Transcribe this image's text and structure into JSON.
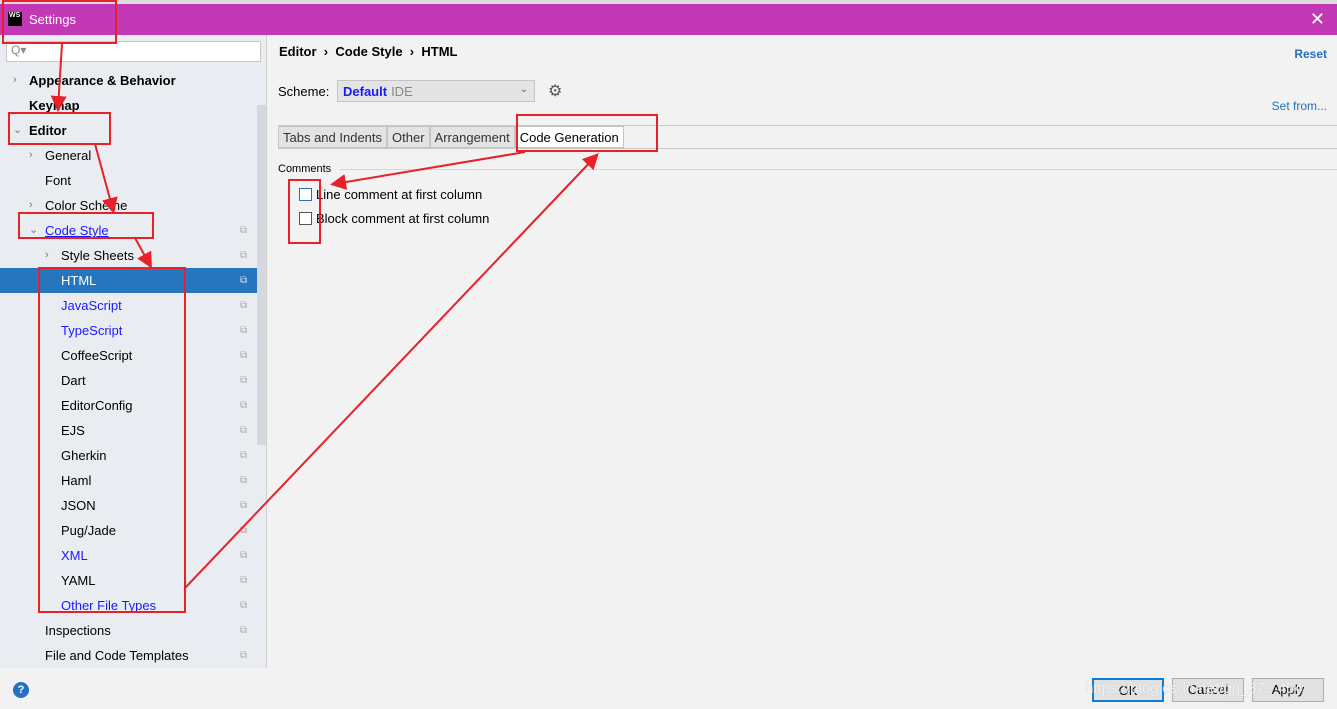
{
  "window": {
    "title": "Settings",
    "logo": "WS",
    "close_icon": "close-icon"
  },
  "sidebar": {
    "search_placeholder": "Q▾",
    "items": [
      {
        "label": "Appearance & Behavior",
        "level": 0,
        "arrow": "›",
        "bold": true
      },
      {
        "label": "Keymap",
        "level": 0,
        "arrow": "",
        "bold": true
      },
      {
        "label": "Editor",
        "level": 0,
        "arrow": "⌄",
        "bold": true
      },
      {
        "label": "General",
        "level": 1,
        "arrow": "›"
      },
      {
        "label": "Font",
        "level": 1,
        "arrow": ""
      },
      {
        "label": "Color Scheme",
        "level": 1,
        "arrow": "›"
      },
      {
        "label": "Code Style",
        "level": 1,
        "arrow": "⌄",
        "link": true,
        "underline": true,
        "copy": true
      },
      {
        "label": "Style Sheets",
        "level": 2,
        "arrow": "›",
        "copy": true
      },
      {
        "label": "HTML",
        "level": 2,
        "arrow": "",
        "selected": true,
        "copy": true
      },
      {
        "label": "JavaScript",
        "level": 2,
        "arrow": "",
        "link": true,
        "copy": true
      },
      {
        "label": "TypeScript",
        "level": 2,
        "arrow": "",
        "link": true,
        "copy": true
      },
      {
        "label": "CoffeeScript",
        "level": 2,
        "arrow": "",
        "copy": true
      },
      {
        "label": "Dart",
        "level": 2,
        "arrow": "",
        "copy": true
      },
      {
        "label": "EditorConfig",
        "level": 2,
        "arrow": "",
        "copy": true
      },
      {
        "label": "EJS",
        "level": 2,
        "arrow": "",
        "copy": true
      },
      {
        "label": "Gherkin",
        "level": 2,
        "arrow": "",
        "copy": true
      },
      {
        "label": "Haml",
        "level": 2,
        "arrow": "",
        "copy": true
      },
      {
        "label": "JSON",
        "level": 2,
        "arrow": "",
        "copy": true
      },
      {
        "label": "Pug/Jade",
        "level": 2,
        "arrow": "",
        "copy": true
      },
      {
        "label": "XML",
        "level": 2,
        "arrow": "",
        "link": true,
        "copy": true
      },
      {
        "label": "YAML",
        "level": 2,
        "arrow": "",
        "copy": true
      },
      {
        "label": "Other File Types",
        "level": 2,
        "arrow": "",
        "link": true,
        "underline": true,
        "copy": true
      },
      {
        "label": "Inspections",
        "level": 1,
        "arrow": "",
        "copy": true
      },
      {
        "label": "File and Code Templates",
        "level": 1,
        "arrow": "",
        "copy": true
      }
    ]
  },
  "main": {
    "breadcrumb": [
      "Editor",
      "Code Style",
      "HTML"
    ],
    "breadcrumb_sep": "›",
    "reset": "Reset",
    "set_from": "Set from...",
    "scheme_label": "Scheme:",
    "scheme_value": "Default",
    "scheme_sub": "IDE",
    "tabs": [
      {
        "label": "Tabs and Indents"
      },
      {
        "label": "Other"
      },
      {
        "label": "Arrangement"
      },
      {
        "label": "Code Generation",
        "active": true
      }
    ],
    "group": "Comments",
    "options": [
      {
        "label": "Line comment at first column",
        "checked": false
      },
      {
        "label": "Block comment at first column",
        "checked": false
      }
    ]
  },
  "footer": {
    "help": "?",
    "ok": "OK",
    "cancel": "Cancel",
    "apply": "Apply"
  },
  "watermark": "https://blog.csdn.net/qq_37...454",
  "colors": {
    "titlebar": "#c238b5",
    "selection": "#2675bf",
    "annotation": "#e8202a",
    "link": "#1a1aff"
  }
}
